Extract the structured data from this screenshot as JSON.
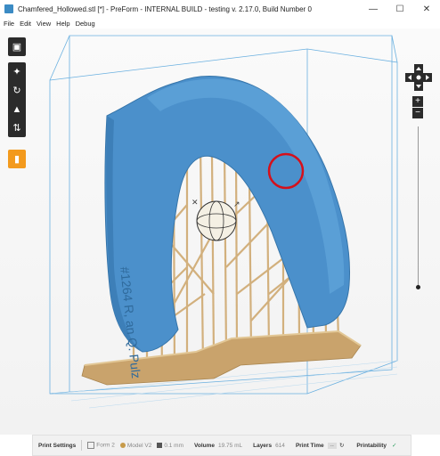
{
  "window": {
    "title": "Chamfered_Hollowed.stl [*] - PreForm - INTERNAL BUILD - testing v. 2.17.0, Build Number 0",
    "minimize_icon": "minimize-icon",
    "maximize_icon": "maximize-icon",
    "close_icon": "close-icon"
  },
  "menu": [
    {
      "label": "File"
    },
    {
      "label": "Edit"
    },
    {
      "label": "View"
    },
    {
      "label": "Help"
    },
    {
      "label": "Debug"
    }
  ],
  "toolbar": {
    "tools": [
      "view-cube-icon",
      "magic-wand-icon",
      "orient-icon",
      "supports-icon",
      "layout-icon",
      "print-icon"
    ]
  },
  "model": {
    "engraving": "#1264 R, an Q. Pulz"
  },
  "status": {
    "print_settings_label": "Print Settings",
    "printer": "Form 2",
    "material": "Model V2",
    "layer_height": "0.1 mm",
    "volume_label": "Volume",
    "volume_value": "19.75 mL",
    "layers_label": "Layers",
    "layers_value": "614",
    "print_time_label": "Print Time",
    "print_time_value": "--",
    "printability_label": "Printability",
    "printability_value": "✓"
  },
  "colors": {
    "model_blue": "#4b90cb",
    "support_tan": "#d2b07d",
    "build_volume_line": "#6ab0e0",
    "highlight_red": "#d5101b",
    "tool_accent": "#f39a1d"
  }
}
